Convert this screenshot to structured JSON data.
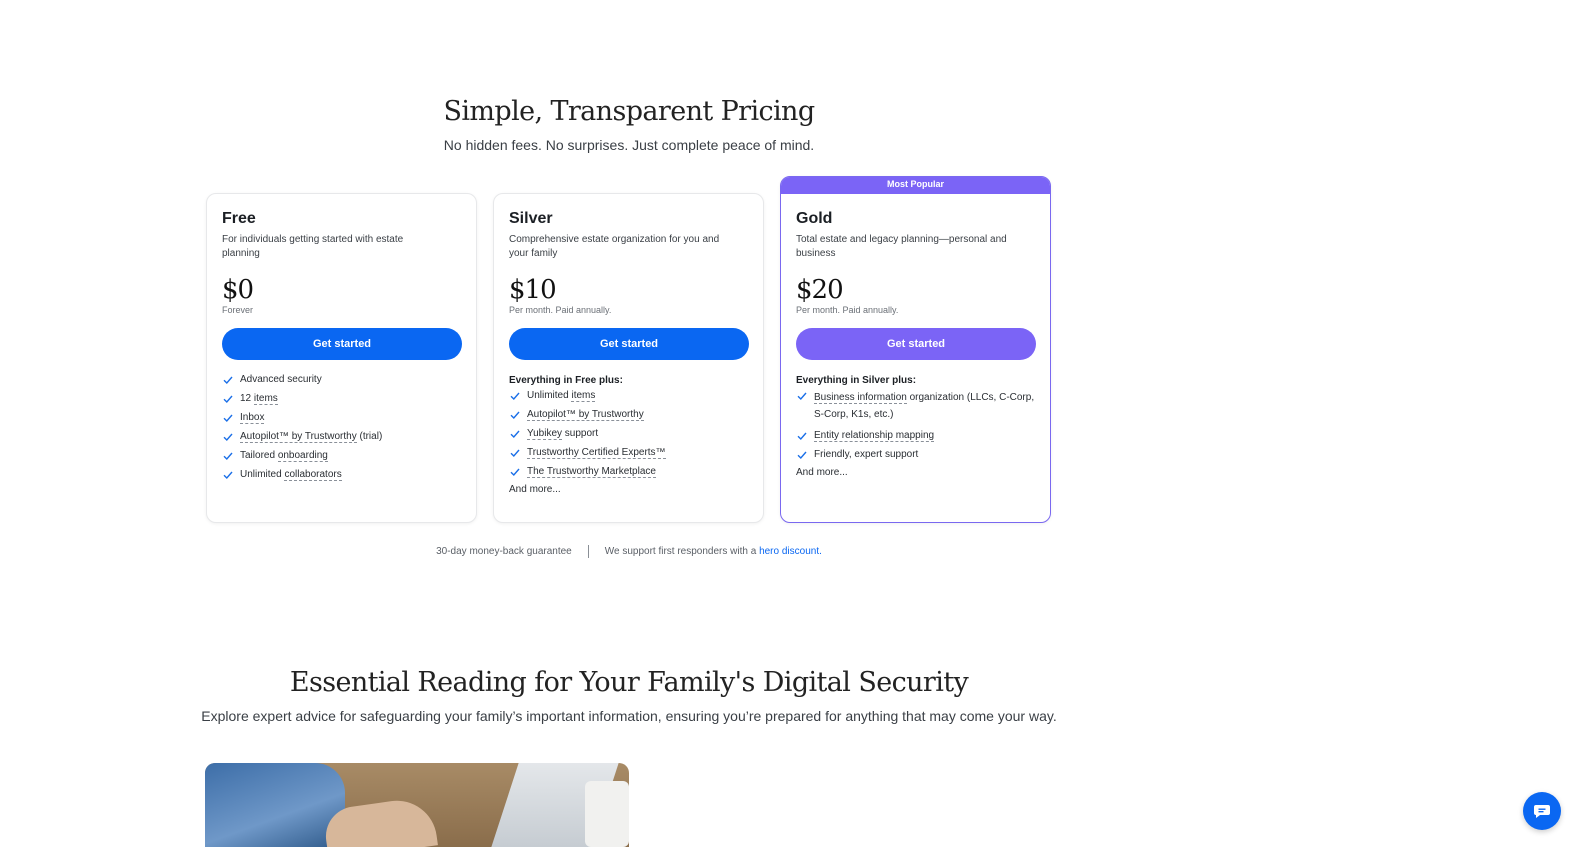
{
  "pricing": {
    "title": "Simple, Transparent Pricing",
    "subtitle": "No hidden fees. No surprises. Just complete peace of mind.",
    "plans": [
      {
        "name": "Free",
        "description": "For individuals getting started with estate planning",
        "price": "$0",
        "note": "Forever",
        "cta": "Get started",
        "features_heading": "",
        "features": [
          {
            "pre": "Advanced security",
            "link": "",
            "post": ""
          },
          {
            "pre": "12 ",
            "link": "items",
            "post": ""
          },
          {
            "pre": "",
            "link": "Inbox",
            "post": ""
          },
          {
            "pre": "",
            "link": "Autopilot™ by Trustworthy",
            "post": " (trial)"
          },
          {
            "pre": "Tailored ",
            "link": "onboarding",
            "post": ""
          },
          {
            "pre": "Unlimited ",
            "link": "collaborators",
            "post": ""
          }
        ],
        "more": ""
      },
      {
        "name": "Silver",
        "description": "Comprehensive estate organization for you and your family",
        "price": "$10",
        "note": "Per month. Paid annually.",
        "cta": "Get started",
        "features_heading": "Everything in Free plus:",
        "features": [
          {
            "pre": "Unlimited ",
            "link": "items",
            "post": ""
          },
          {
            "pre": "",
            "link": "Autopilot™ by Trustworthy",
            "post": ""
          },
          {
            "pre": "",
            "link": "Yubikey",
            "post": " support"
          },
          {
            "pre": "",
            "link": "Trustworthy Certified Experts™",
            "post": ""
          },
          {
            "pre": "",
            "link": "The Trustworthy Marketplace",
            "post": ""
          }
        ],
        "more": "And more..."
      },
      {
        "badge": "Most Popular",
        "name": "Gold",
        "description": "Total estate and legacy planning—personal and business",
        "price": "$20",
        "note": "Per month. Paid annually.",
        "cta": "Get started",
        "features_heading": "Everything in Silver plus:",
        "features": [
          {
            "pre": "",
            "link": "Business information",
            "post": " organization (LLCs, C-Corp, S-Corp, K1s, etc.)"
          },
          {
            "pre": "",
            "link": "Entity relationship mapping",
            "post": ""
          },
          {
            "pre": "Friendly, expert support",
            "link": "",
            "post": ""
          }
        ],
        "more": "And more..."
      }
    ],
    "guarantee": "30-day money-back guarantee",
    "responders_text": "We support first responders with a ",
    "responders_link": "hero discount."
  },
  "reading": {
    "title": "Essential Reading for Your Family's Digital Security",
    "subtitle": "Explore expert advice for safeguarding your family’s important information, ensuring you’re prepared for anything that may come your way."
  },
  "colors": {
    "primary": "#0a67f2",
    "gold_accent": "#7b64f6",
    "check": "#1a6fe8"
  },
  "icons": {
    "feature_check": "check-icon",
    "chat": "chat-icon"
  }
}
